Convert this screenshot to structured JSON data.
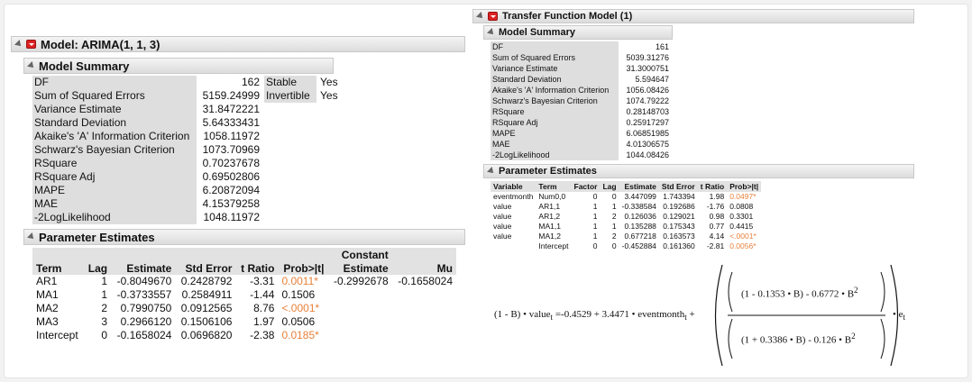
{
  "left": {
    "title": "Model: ARIMA(1, 1, 3)",
    "summary_title": "Model Summary",
    "summary": [
      {
        "label": "DF",
        "value": "162"
      },
      {
        "label": "Sum of Squared Errors",
        "value": "5159.24999"
      },
      {
        "label": "Variance Estimate",
        "value": "31.8472221"
      },
      {
        "label": "Standard Deviation",
        "value": "5.64333431"
      },
      {
        "label": "Akaike's 'A' Information Criterion",
        "value": "1058.11972"
      },
      {
        "label": "Schwarz's Bayesian Criterion",
        "value": "1073.70969"
      },
      {
        "label": "RSquare",
        "value": "0.70237678"
      },
      {
        "label": "RSquare Adj",
        "value": "0.69502806"
      },
      {
        "label": "MAPE",
        "value": "6.20872094"
      },
      {
        "label": "MAE",
        "value": "4.15379258"
      },
      {
        "label": "-2LogLikelihood",
        "value": "1048.11972"
      }
    ],
    "stable_label": "Stable",
    "stable_value": "Yes",
    "invertible_label": "Invertible",
    "invertible_value": "Yes",
    "params_title": "Parameter Estimates",
    "params_headers": {
      "term": "Term",
      "lag": "Lag",
      "estimate": "Estimate",
      "std_error": "Std Error",
      "t_ratio": "t Ratio",
      "prob": "Prob>|t|",
      "const_1": "Constant",
      "const_2": "Estimate",
      "mu": "Mu"
    },
    "params": [
      {
        "term": "AR1",
        "lag": "1",
        "estimate": "-0.8049670",
        "std_error": "0.2428792",
        "t_ratio": "-3.31",
        "prob": "0.0011*"
      },
      {
        "term": "MA1",
        "lag": "1",
        "estimate": "-0.3733557",
        "std_error": "0.2584911",
        "t_ratio": "-1.44",
        "prob": "0.1506"
      },
      {
        "term": "MA2",
        "lag": "2",
        "estimate": "0.7990750",
        "std_error": "0.0912565",
        "t_ratio": "8.76",
        "prob": "<.0001*"
      },
      {
        "term": "MA3",
        "lag": "3",
        "estimate": "0.2966120",
        "std_error": "0.1506106",
        "t_ratio": "1.97",
        "prob": "0.0506"
      },
      {
        "term": "Intercept",
        "lag": "0",
        "estimate": "-0.1658024",
        "std_error": "0.0696820",
        "t_ratio": "-2.38",
        "prob": "0.0185*"
      }
    ],
    "constant_estimate": "-0.2992678",
    "mu": "-0.1658024"
  },
  "right": {
    "title": "Transfer Function Model (1)",
    "summary_title": "Model Summary",
    "summary": [
      {
        "label": "DF",
        "value": "161"
      },
      {
        "label": "Sum of Squared Errors",
        "value": "5039.31276"
      },
      {
        "label": "Variance Estimate",
        "value": "31.3000751"
      },
      {
        "label": "Standard Deviation",
        "value": "5.594647"
      },
      {
        "label": "Akaike's 'A' Information Criterion",
        "value": "1056.08426"
      },
      {
        "label": "Schwarz's Bayesian Criterion",
        "value": "1074.79222"
      },
      {
        "label": "RSquare",
        "value": "0.28148703"
      },
      {
        "label": "RSquare Adj",
        "value": "0.25917297"
      },
      {
        "label": "MAPE",
        "value": "6.06851985"
      },
      {
        "label": "MAE",
        "value": "4.01306575"
      },
      {
        "label": "-2LogLikelihood",
        "value": "1044.08426"
      }
    ],
    "params_title": "Parameter Estimates",
    "params_headers": {
      "variable": "Variable",
      "term": "Term",
      "factor": "Factor",
      "lag": "Lag",
      "estimate": "Estimate",
      "std_error": "Std Error",
      "t_ratio": "t Ratio",
      "prob": "Prob>|t|"
    },
    "params": [
      {
        "variable": "eventmonth",
        "term": "Num0,0",
        "factor": "0",
        "lag": "0",
        "estimate": "3.447099",
        "std_error": "1.743394",
        "t_ratio": "1.98",
        "prob": "0.0497*"
      },
      {
        "variable": "value",
        "term": "AR1,1",
        "factor": "1",
        "lag": "1",
        "estimate": "-0.338584",
        "std_error": "0.192686",
        "t_ratio": "-1.76",
        "prob": "0.0808"
      },
      {
        "variable": "value",
        "term": "AR1,2",
        "factor": "1",
        "lag": "2",
        "estimate": "0.126036",
        "std_error": "0.129021",
        "t_ratio": "0.98",
        "prob": "0.3301"
      },
      {
        "variable": "value",
        "term": "MA1,1",
        "factor": "1",
        "lag": "1",
        "estimate": "0.135288",
        "std_error": "0.175343",
        "t_ratio": "0.77",
        "prob": "0.4415"
      },
      {
        "variable": "value",
        "term": "MA1,2",
        "factor": "1",
        "lag": "2",
        "estimate": "0.677218",
        "std_error": "0.163573",
        "t_ratio": "4.14",
        "prob": "<.0001*"
      },
      {
        "variable": "",
        "term": "Intercept",
        "factor": "0",
        "lag": "0",
        "estimate": "-0.452884",
        "std_error": "0.161360",
        "t_ratio": "-2.81",
        "prob": "0.0056*"
      }
    ],
    "equation": {
      "lhs_factor": "(1 - B)",
      "dot": "•",
      "lhs_var": "value",
      "sub_t": "t",
      "equals": "=",
      "const": "-0.4529",
      "plus": "+",
      "coef": "3.4471",
      "x_var": "eventmonth",
      "num_inner": "(1 - 0.1353 • B)",
      "num_tail": "- 0.6772 • B",
      "den_inner": "(1 + 0.3386 • B)",
      "den_tail": "- 0.126 • B",
      "sup2": "2",
      "err": "e"
    }
  },
  "colors": {
    "significant": "#e8813a",
    "header_bg": "#dcdcdc",
    "label_bg": "#dedede",
    "red_button": "#dd2222"
  }
}
